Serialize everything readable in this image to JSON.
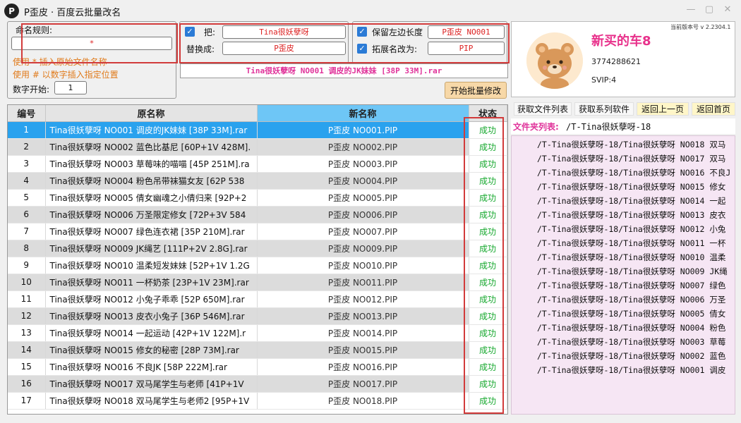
{
  "window": {
    "logo_letter": "P",
    "title": "P歪皮 · 百度云批量改名",
    "minimize": "—",
    "maximize": "▢",
    "close": "✕"
  },
  "rules": {
    "naming_label": "命名规则:",
    "naming_value": "*",
    "hint1": "使用 * 插入原始文件名称",
    "hint2": "使用 # 以数字插入指定位置",
    "num_start_label": "数字开始:",
    "num_start_value": "1"
  },
  "replace": {
    "find_label": "把:",
    "find_value": "Tina很妖孽呀",
    "replace_label": "替换成:",
    "replace_value": "P歪皮",
    "find_checked": true
  },
  "options": {
    "keep_left_label": "保留左边长度",
    "keep_left_value": "P歪皮 NO001",
    "ext_label": "拓展名改为:",
    "ext_value": "PIP",
    "keep_left_checked": true,
    "ext_checked": true
  },
  "preview_text": "Tina很妖孽呀 NO001 调皮的JK妹妹 [38P 33M].rar",
  "start_button": "开始批量修改",
  "profile": {
    "username": "新买的车8",
    "user_id": "3774288621",
    "svip": "SVIP:4",
    "version": "当前版本号 v 2.2304.1"
  },
  "table": {
    "headers": [
      "编号",
      "原名称",
      "新名称",
      "状态"
    ],
    "rows": [
      {
        "num": "1",
        "orig": "Tina很妖孽呀 NO001 调皮的JK妹妹 [38P 33M].rar",
        "new": "P歪皮 NO001.PIP",
        "status": "成功"
      },
      {
        "num": "2",
        "orig": "Tina很妖孽呀 NO002 蓝色比基尼 [60P+1V 428M].",
        "new": "P歪皮 NO002.PIP",
        "status": "成功"
      },
      {
        "num": "3",
        "orig": "Tina很妖孽呀 NO003 草莓味的喵喵 [45P 251M].ra",
        "new": "P歪皮 NO003.PIP",
        "status": "成功"
      },
      {
        "num": "4",
        "orig": "Tina很妖孽呀 NO004 粉色吊带袜猫女友 [62P 538",
        "new": "P歪皮 NO004.PIP",
        "status": "成功"
      },
      {
        "num": "5",
        "orig": "Tina很妖孽呀 NO005 倩女幽魂之小倩归来 [92P+2",
        "new": "P歪皮 NO005.PIP",
        "status": "成功"
      },
      {
        "num": "6",
        "orig": "Tina很妖孽呀 NO006 万圣限定修女 [72P+3V 584",
        "new": "P歪皮 NO006.PIP",
        "status": "成功"
      },
      {
        "num": "7",
        "orig": "Tina很妖孽呀 NO007 绿色连衣裙 [35P 210M].rar",
        "new": "P歪皮 NO007.PIP",
        "status": "成功"
      },
      {
        "num": "8",
        "orig": "Tina很妖孽呀 NO009 JK绳艺 [111P+2V 2.8G].rar",
        "new": "P歪皮 NO009.PIP",
        "status": "成功"
      },
      {
        "num": "9",
        "orig": "Tina很妖孽呀 NO010 温柔短发妹妹 [52P+1V 1.2G",
        "new": "P歪皮 NO010.PIP",
        "status": "成功"
      },
      {
        "num": "10",
        "orig": "Tina很妖孽呀 NO011 一杯奶茶 [23P+1V 23M].rar",
        "new": "P歪皮 NO011.PIP",
        "status": "成功"
      },
      {
        "num": "11",
        "orig": "Tina很妖孽呀 NO012 小兔子乖乖 [52P 650M].rar",
        "new": "P歪皮 NO012.PIP",
        "status": "成功"
      },
      {
        "num": "12",
        "orig": "Tina很妖孽呀 NO013 皮衣小兔子 [36P 546M].rar",
        "new": "P歪皮 NO013.PIP",
        "status": "成功"
      },
      {
        "num": "13",
        "orig": "Tina很妖孽呀 NO014 一起运动 [42P+1V 122M].r",
        "new": "P歪皮 NO014.PIP",
        "status": "成功"
      },
      {
        "num": "14",
        "orig": "Tina很妖孽呀 NO015 修女的秘密 [28P 73M].rar",
        "new": "P歪皮 NO015.PIP",
        "status": "成功"
      },
      {
        "num": "15",
        "orig": "Tina很妖孽呀 NO016 不良JK [58P 222M].rar",
        "new": "P歪皮 NO016.PIP",
        "status": "成功"
      },
      {
        "num": "16",
        "orig": "Tina很妖孽呀 NO017 双马尾学生与老师 [41P+1V",
        "new": "P歪皮 NO017.PIP",
        "status": "成功"
      },
      {
        "num": "17",
        "orig": "Tina很妖孽呀 NO018 双马尾学生与老师2 [95P+1V",
        "new": "P歪皮 NO018.PIP",
        "status": "成功"
      }
    ]
  },
  "right_toolbar": [
    "获取文件列表",
    "获取系列软件",
    "返回上一页",
    "返回首页"
  ],
  "folder": {
    "label": "文件夹列表:",
    "path": "/T-Tina很妖孽呀-18",
    "items": [
      "/T-Tina很妖孽呀-18/Tina很妖孽呀 NO018 双马",
      "/T-Tina很妖孽呀-18/Tina很妖孽呀 NO017 双马",
      "/T-Tina很妖孽呀-18/Tina很妖孽呀 NO016 不良J",
      "/T-Tina很妖孽呀-18/Tina很妖孽呀 NO015 修女",
      "/T-Tina很妖孽呀-18/Tina很妖孽呀 NO014  一起",
      "/T-Tina很妖孽呀-18/Tina很妖孽呀 NO013 皮衣",
      "/T-Tina很妖孽呀-18/Tina很妖孽呀 NO012 小兔",
      "/T-Tina很妖孽呀-18/Tina很妖孽呀 NO011 一杯",
      "/T-Tina很妖孽呀-18/Tina很妖孽呀 NO010 温柔",
      "/T-Tina很妖孽呀-18/Tina很妖孽呀 NO009 JK绳",
      "/T-Tina很妖孽呀-18/Tina很妖孽呀 NO007 绿色",
      "/T-Tina很妖孽呀-18/Tina很妖孽呀 NO006 万圣",
      "/T-Tina很妖孽呀-18/Tina很妖孽呀 NO005 倩女",
      "/T-Tina很妖孽呀-18/Tina很妖孽呀 NO004 粉色",
      "/T-Tina很妖孽呀-18/Tina很妖孽呀 NO003 草莓",
      "/T-Tina很妖孽呀-18/Tina很妖孽呀 NO002 蓝色",
      "/T-Tina很妖孽呀-18/Tina很妖孽呀 NO001 调皮"
    ]
  },
  "colors": {
    "accent_blue": "#2aa2ee",
    "header_blue": "#6ec6f6",
    "success_green": "#15a82d",
    "highlight_red": "#d23b3b",
    "pink": "#e8318b"
  }
}
